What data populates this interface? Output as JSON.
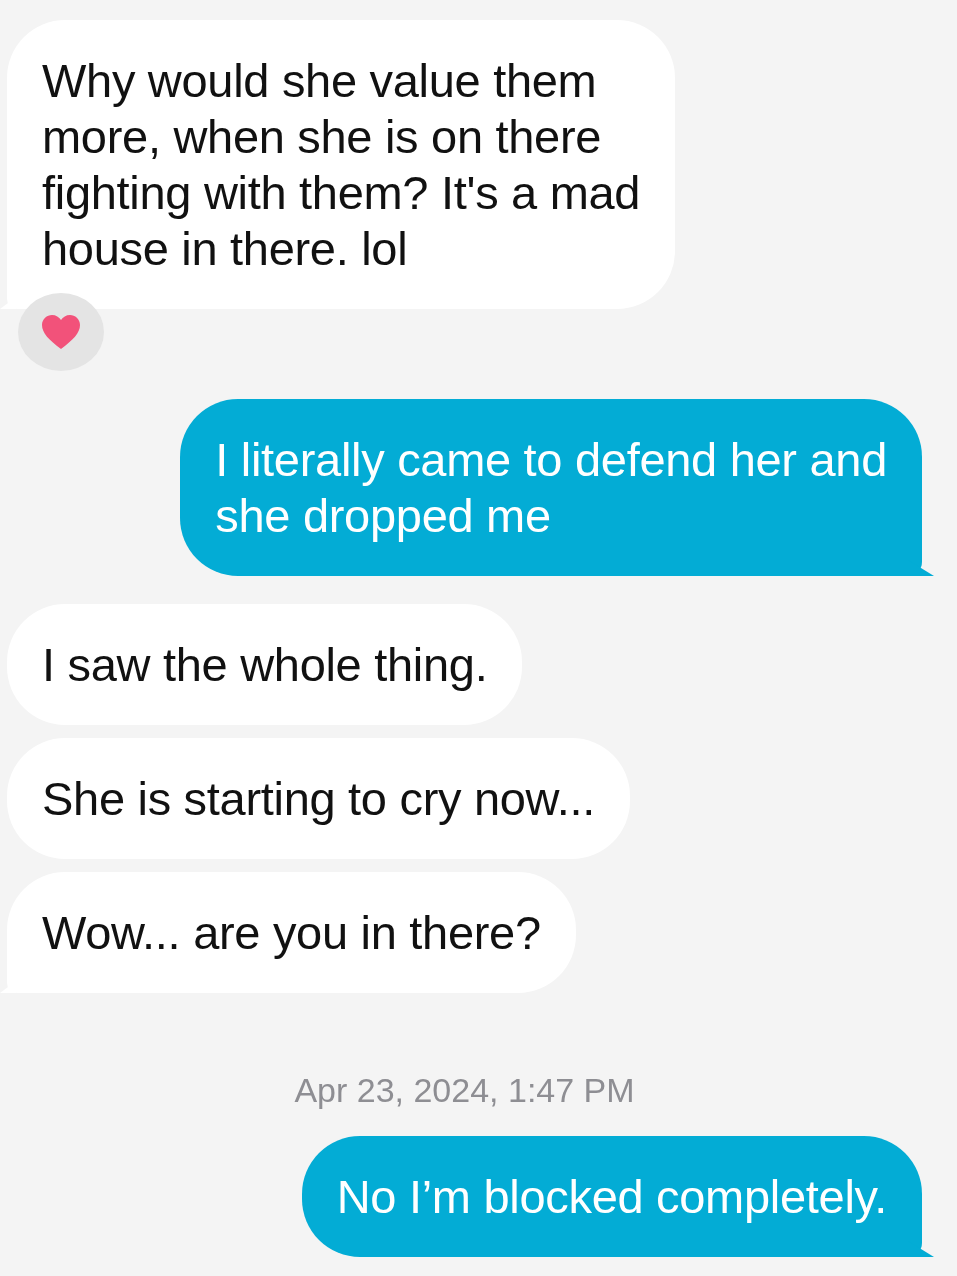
{
  "conversation": [
    {
      "kind": "incoming",
      "text": "Why would she value them\nmore, when she is on there\nfighting with them? It's a mad\nhouse in there. lol",
      "tail": true,
      "reacted": true
    },
    {
      "kind": "outgoing",
      "text": "I literally came to defend her and\nshe dropped me",
      "tail": true,
      "reacted": false
    },
    {
      "kind": "incoming",
      "text": "I saw the whole thing.",
      "tail": false,
      "reacted": false
    },
    {
      "kind": "incoming",
      "text": "She is starting to cry now...",
      "tail": false,
      "reacted": false
    },
    {
      "kind": "incoming",
      "text": "Wow... are you in there?",
      "tail": true,
      "reacted": false
    },
    {
      "kind": "timestamp",
      "text": "Apr 23, 2024, 1:47 PM"
    },
    {
      "kind": "outgoing",
      "text": "No I’m blocked completely.",
      "tail": true,
      "reacted": false
    }
  ]
}
